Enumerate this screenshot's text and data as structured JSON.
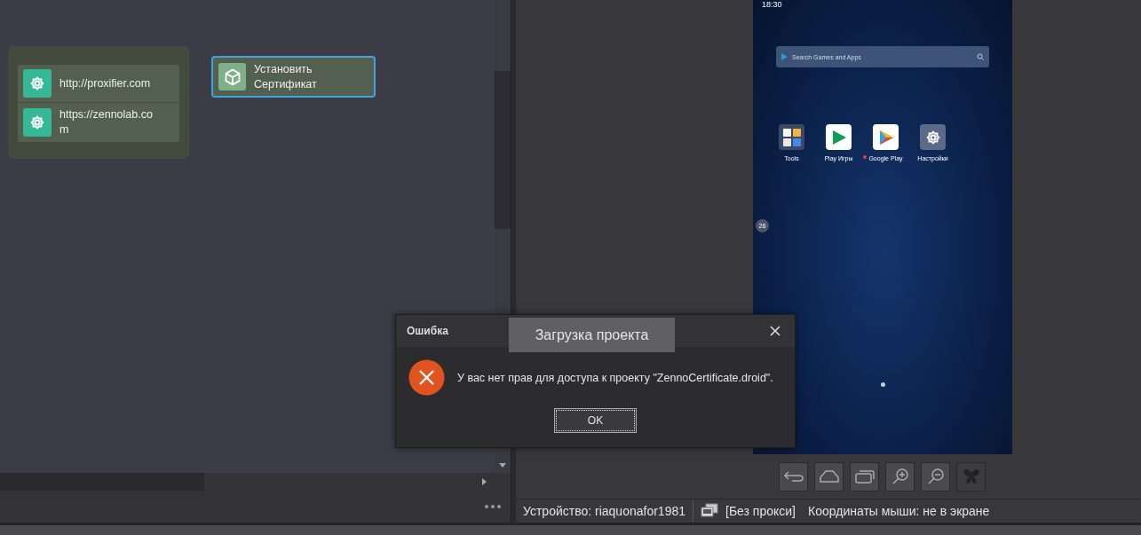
{
  "canvas": {
    "group_items": [
      {
        "label": "http://proxifier.com"
      },
      {
        "label": "https://zennolab.com"
      }
    ],
    "action_node": {
      "label": "Установить Сертификат",
      "selected": true
    }
  },
  "phone": {
    "time": "18:30",
    "search_placeholder": "Search Games and Apps",
    "apps": [
      {
        "label": "Tools",
        "kind": "folder",
        "notification": false
      },
      {
        "label": "Play Игры",
        "kind": "games",
        "notification": false
      },
      {
        "label": "Google Play",
        "kind": "store",
        "notification": true
      },
      {
        "label": "Настройки",
        "kind": "settings",
        "notification": false
      }
    ],
    "progress_badge": "26"
  },
  "device_buttons": [
    {
      "kind": "back",
      "disabled": false
    },
    {
      "kind": "home",
      "disabled": false
    },
    {
      "kind": "recent",
      "disabled": false
    },
    {
      "kind": "zoom_in",
      "disabled": false
    },
    {
      "kind": "zoom_out",
      "disabled": false
    },
    {
      "kind": "bug",
      "disabled": true
    }
  ],
  "status_bar": {
    "device": "Устройство: riaquonafor1981",
    "proxy": "[Без прокси]",
    "mouse": "Координаты мыши: не в экране"
  },
  "dialog": {
    "title": "Ошибка",
    "message": "У вас нет прав для доступа к проекту \"ZennoCertificate.droid\".",
    "button": "OK"
  },
  "loading_label": "Загрузка проекта"
}
